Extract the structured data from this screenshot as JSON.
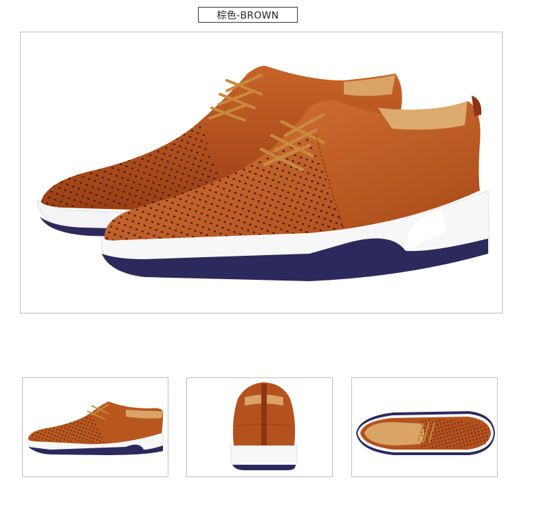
{
  "product": {
    "color_label": "棕色-BROWN",
    "color_hex": "#b4521e",
    "sole_hex": "#ffffff",
    "midsole_hex": "#2c2a5c"
  },
  "views": [
    {
      "name": "pair-side-view"
    },
    {
      "name": "side-profile-view"
    },
    {
      "name": "heel-back-view"
    },
    {
      "name": "top-down-view"
    }
  ]
}
